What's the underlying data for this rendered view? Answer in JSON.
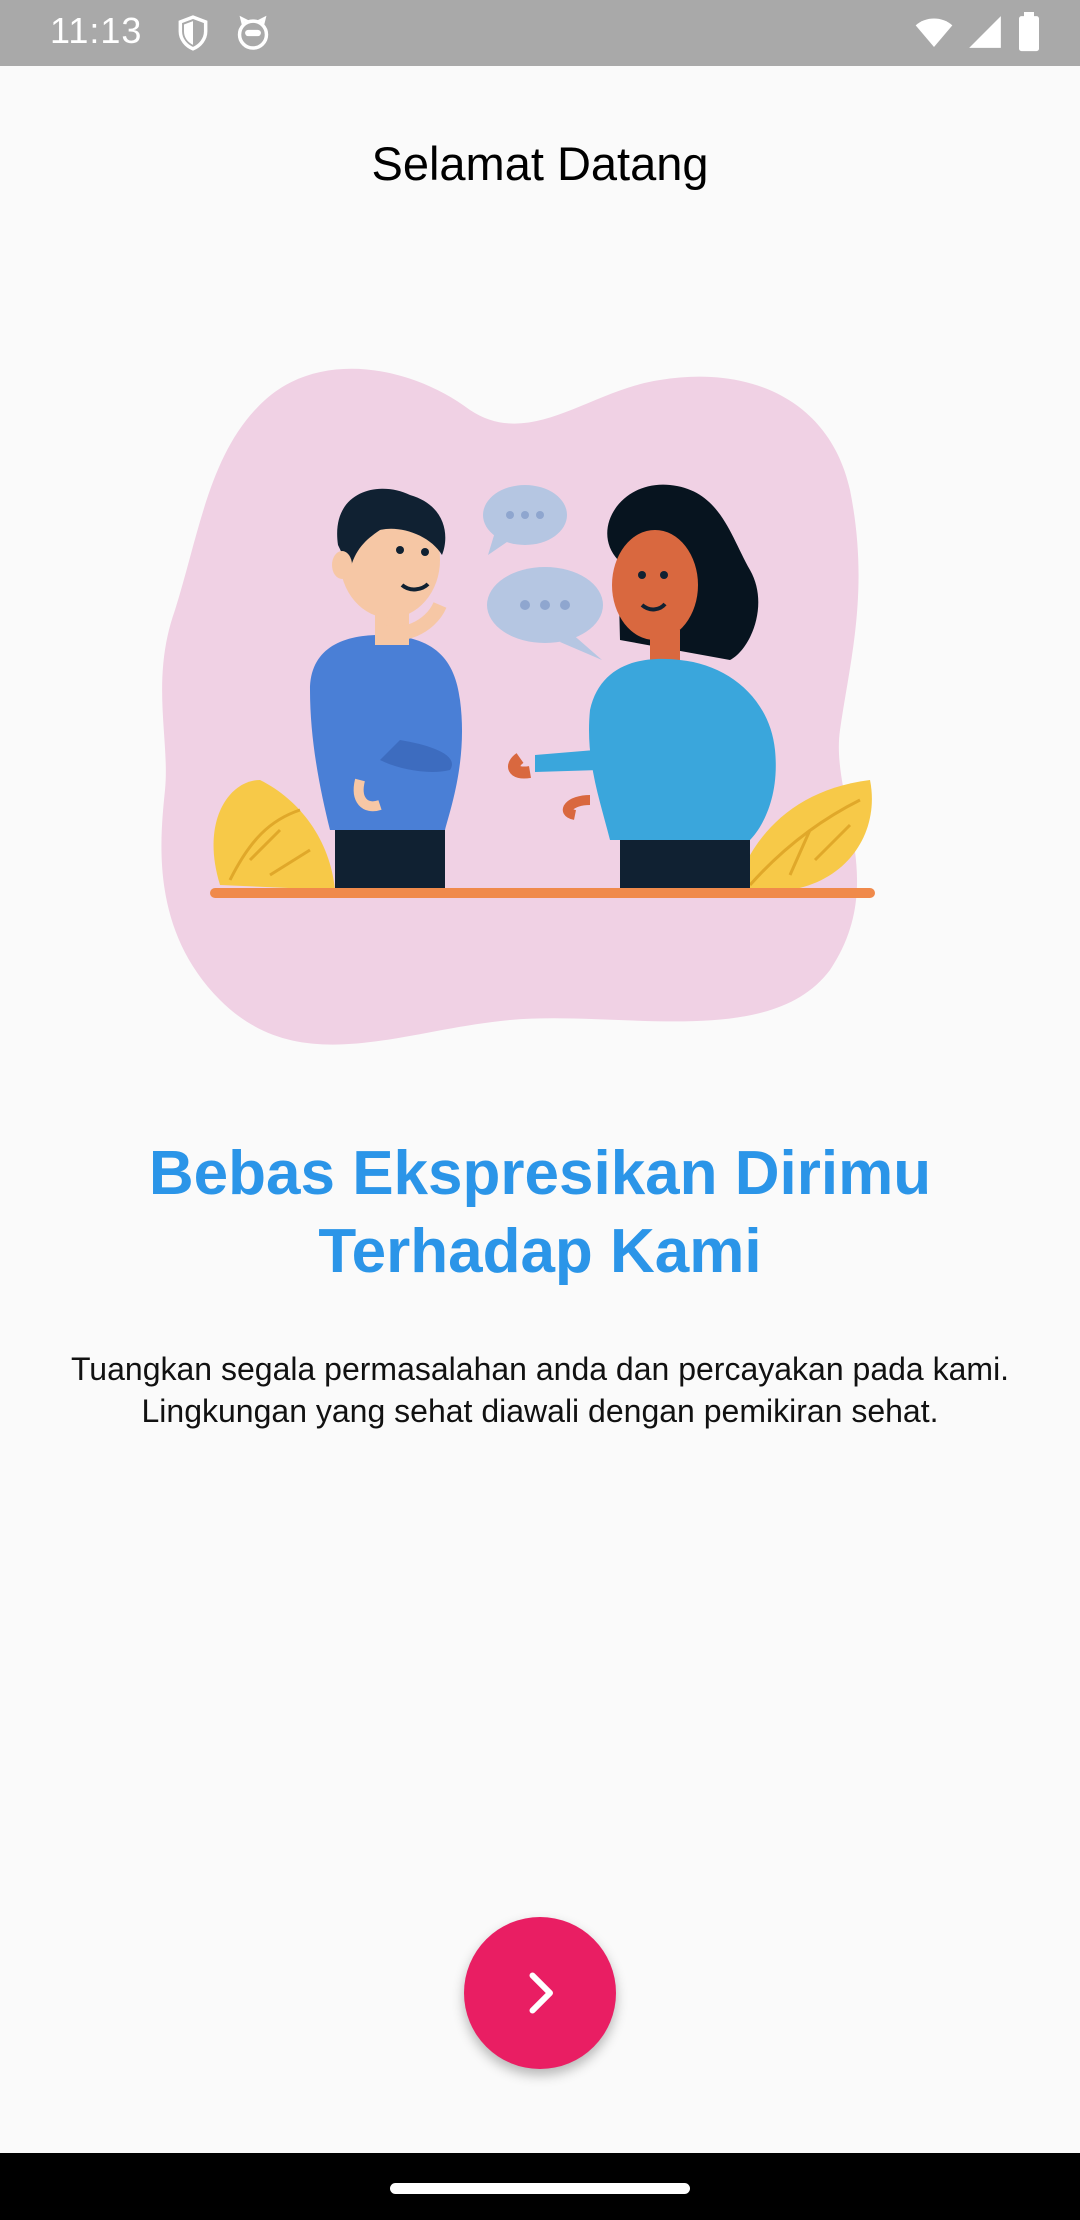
{
  "status_bar": {
    "time": "11:13",
    "left_icons": [
      "shield-icon",
      "cat-face-icon"
    ],
    "right_icons": [
      "wifi-icon",
      "cellular-signal-icon",
      "battery-icon"
    ]
  },
  "page": {
    "title": "Selamat Datang"
  },
  "onboarding": {
    "headline": "Bebas Ekspresikan Dirimu Terhadap Kami",
    "description": "Tuangkan segala permasalahan anda dan percayakan pada kami. Lingkungan yang sehat diawali dengan pemikiran sehat."
  },
  "next_button": {
    "icon": "chevron-right-icon"
  },
  "colors": {
    "accent": "#2b95e8",
    "fab": "#e91e63",
    "status_bar": "#a9a9a9",
    "blob": "#f0d1e4"
  }
}
